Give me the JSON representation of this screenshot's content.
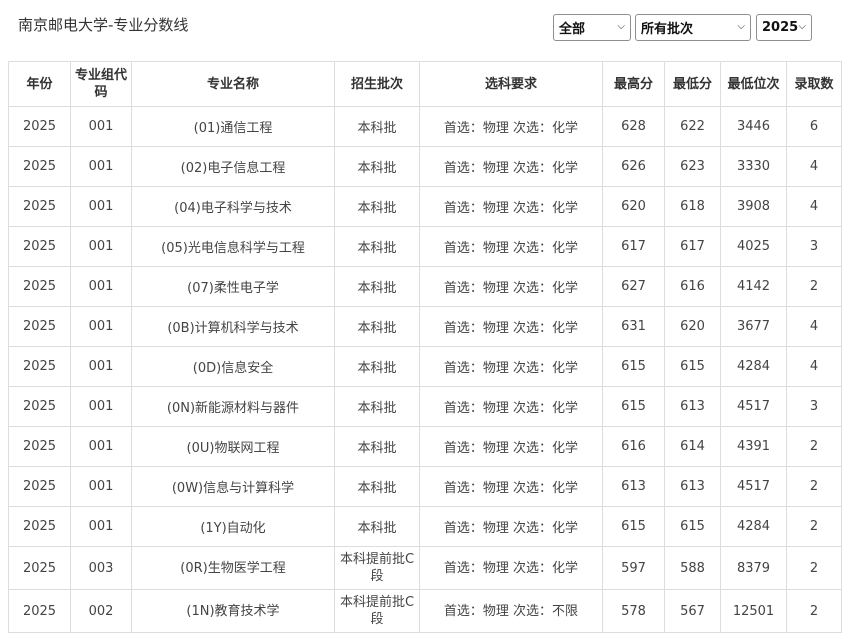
{
  "page_title": "南京邮电大学-专业分数线",
  "filters": {
    "province": "全部",
    "batch": "所有批次",
    "year": "2025"
  },
  "table": {
    "headers": [
      "年份",
      "专业组代码",
      "专业名称",
      "招生批次",
      "选科要求",
      "最高分",
      "最低分",
      "最低位次",
      "录取数"
    ],
    "rows": [
      [
        "2025",
        "001",
        "(01)通信工程",
        "本科批",
        "首选：物理 次选：化学",
        "628",
        "622",
        "3446",
        "6"
      ],
      [
        "2025",
        "001",
        "(02)电子信息工程",
        "本科批",
        "首选：物理 次选：化学",
        "626",
        "623",
        "3330",
        "4"
      ],
      [
        "2025",
        "001",
        "(04)电子科学与技术",
        "本科批",
        "首选：物理 次选：化学",
        "620",
        "618",
        "3908",
        "4"
      ],
      [
        "2025",
        "001",
        "(05)光电信息科学与工程",
        "本科批",
        "首选：物理 次选：化学",
        "617",
        "617",
        "4025",
        "3"
      ],
      [
        "2025",
        "001",
        "(07)柔性电子学",
        "本科批",
        "首选：物理 次选：化学",
        "627",
        "616",
        "4142",
        "2"
      ],
      [
        "2025",
        "001",
        "(0B)计算机科学与技术",
        "本科批",
        "首选：物理 次选：化学",
        "631",
        "620",
        "3677",
        "4"
      ],
      [
        "2025",
        "001",
        "(0D)信息安全",
        "本科批",
        "首选：物理 次选：化学",
        "615",
        "615",
        "4284",
        "4"
      ],
      [
        "2025",
        "001",
        "(0N)新能源材料与器件",
        "本科批",
        "首选：物理 次选：化学",
        "615",
        "613",
        "4517",
        "3"
      ],
      [
        "2025",
        "001",
        "(0U)物联网工程",
        "本科批",
        "首选：物理 次选：化学",
        "616",
        "614",
        "4391",
        "2"
      ],
      [
        "2025",
        "001",
        "(0W)信息与计算科学",
        "本科批",
        "首选：物理 次选：化学",
        "613",
        "613",
        "4517",
        "2"
      ],
      [
        "2025",
        "001",
        "(1Y)自动化",
        "本科批",
        "首选：物理 次选：化学",
        "615",
        "615",
        "4284",
        "2"
      ],
      [
        "2025",
        "003",
        "(0R)生物医学工程",
        "本科提前批C段",
        "首选：物理 次选：化学",
        "597",
        "588",
        "8379",
        "2"
      ],
      [
        "2025",
        "002",
        "(1N)教育技术学",
        "本科提前批C段",
        "首选：物理 次选：不限",
        "578",
        "567",
        "12501",
        "2"
      ]
    ]
  }
}
